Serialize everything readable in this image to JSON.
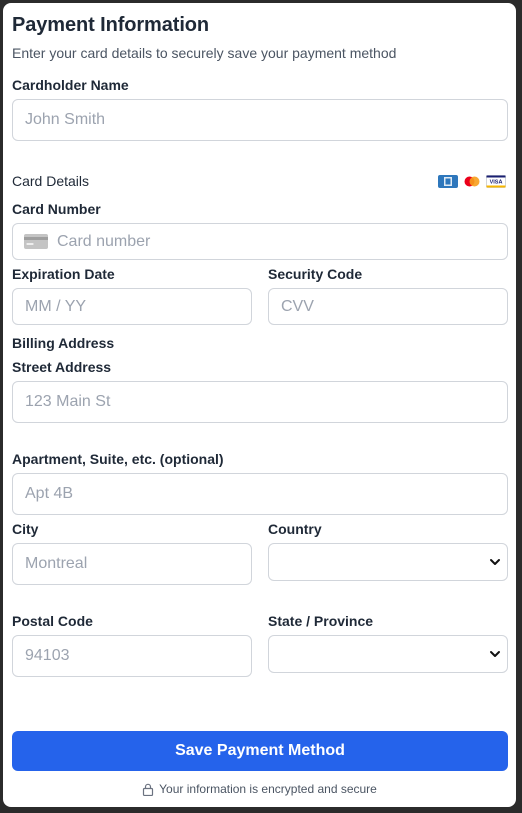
{
  "header": {
    "title": "Payment Information",
    "subtitle": "Enter your card details to securely save your payment method"
  },
  "cardholder": {
    "label": "Cardholder Name",
    "placeholder": "John Smith"
  },
  "card_details": {
    "section_label": "Card Details",
    "brand_icons": [
      "amex-icon",
      "mastercard-icon",
      "visa-icon"
    ],
    "brand_visa_text": "VISA",
    "number_label": "Card Number",
    "number_placeholder": "Card number",
    "expiry_label": "Expiration Date",
    "expiry_placeholder": "MM / YY",
    "cvv_label": "Security Code",
    "cvv_placeholder": "CVV"
  },
  "billing": {
    "section_label": "Billing Address",
    "street_label": "Street Address",
    "street_placeholder": "123 Main St",
    "apt_label": "Apartment, Suite, etc. (optional)",
    "apt_placeholder": "Apt 4B",
    "city_label": "City",
    "city_placeholder": "Montreal",
    "country_label": "Country",
    "country_value": "",
    "postal_label": "Postal Code",
    "postal_placeholder": "94103",
    "state_label": "State / Province",
    "state_value": ""
  },
  "actions": {
    "save_label": "Save Payment Method",
    "secure_note": "Your information is encrypted and secure"
  },
  "colors": {
    "primary": "#2563eb",
    "border": "#d1d5db",
    "text": "#1f2937",
    "muted": "#4b5563",
    "placeholder": "#9ca3af"
  }
}
